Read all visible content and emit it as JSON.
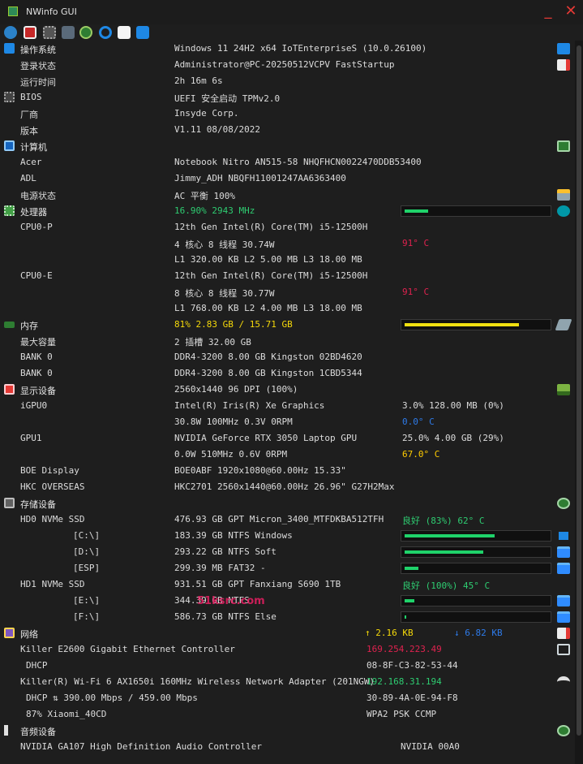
{
  "window": {
    "title": "NWinfo GUI",
    "minimize_glyph": "_",
    "close_glyph": "✕"
  },
  "toolbar": {
    "icons": [
      "globe-icon",
      "red-chip-icon",
      "chip-icon",
      "network-card-icon",
      "gear-icon",
      "refresh-icon",
      "clipboard-icon",
      "info-icon"
    ]
  },
  "os": {
    "label": "操作系统",
    "value": "Windows 11 24H2 x64 IoTEnterpriseS (10.0.26100)",
    "login_label": "登录状态",
    "login_value": "Administrator@PC-20250512VCPV FastStartup",
    "uptime_label": "运行时间",
    "uptime_value": "2h 16m 6s"
  },
  "bios": {
    "label": "BIOS",
    "value": "UEFI 安全启动 TPMv2.0",
    "vendor_label": "厂商",
    "vendor_value": "Insyde Corp.",
    "version_label": "版本",
    "version_value": "V1.11 08/08/2022"
  },
  "computer": {
    "label": "计算机",
    "acer_label": "Acer",
    "acer_value": "Notebook Nitro AN515-58 NHQFHCN0022470DDB53400",
    "adl_label": "ADL",
    "adl_value": "Jimmy_ADH NBQFH11001247AA6363400",
    "power_label": "电源状态",
    "power_value": "AC  平衡 100%"
  },
  "cpu": {
    "label": "处理器",
    "value": "16.90% 2943 MHz",
    "usage_fraction": 0.169,
    "p_label": "CPU0-P",
    "p_name": "12th Gen Intel(R) Core(TM) i5-12500H",
    "p_cores": "4 核心 8 线程 30.74W",
    "p_temp": "91° C",
    "p_cache": "L1 320.00 KB L2 5.00 MB L3 18.00 MB",
    "e_label": "CPU0-E",
    "e_name": "12th Gen Intel(R) Core(TM) i5-12500H",
    "e_cores": "8 核心 8 线程 30.77W",
    "e_temp": "91° C",
    "e_cache": "L1 768.00 KB L2 4.00 MB L3 18.00 MB"
  },
  "memory": {
    "label": "内存",
    "value": "81% 2.83 GB / 15.71 GB",
    "usage_fraction": 0.81,
    "max_label": "最大容量",
    "max_value": "2 插槽 32.00 GB",
    "bank0_label": "BANK 0",
    "bank0_value": "DDR4-3200 8.00 GB Kingston 02BD4620",
    "bank1_label": "BANK 0",
    "bank1_value": "DDR4-3200 8.00 GB Kingston 1CBD5344"
  },
  "display": {
    "label": "显示设备",
    "value": "2560x1440 96 DPI (100%)",
    "igpu_label": "iGPU0",
    "igpu_name": "Intel(R) Iris(R) Xe Graphics",
    "igpu_usage": "3.0%   128.00 MB (0%)",
    "igpu_power": "30.8W 100MHz 0.3V 0RPM",
    "igpu_temp": "0.0° C",
    "gpu1_label": "GPU1",
    "gpu1_name": "NVIDIA GeForce RTX 3050 Laptop GPU",
    "gpu1_usage": "25.0%  4.00 GB (29%)",
    "gpu1_power": "0.0W 510MHz 0.6V 0RPM",
    "gpu1_temp": "67.0° C",
    "mon1_label": "BOE Display",
    "mon1_value": "BOE0ABF 1920x1080@60.00Hz 15.33\"",
    "mon2_label": "HKC OVERSEAS",
    "mon2_value": "HKC2701 2560x1440@60.00Hz 26.96\" G27H2Max"
  },
  "storage": {
    "label": "存储设备",
    "hd0_label": "HD0 NVMe SSD",
    "hd0_value": "476.93 GB GPT Micron_3400_MTFDKBA512TFH",
    "hd0_health": "良好 (83%) 62° C",
    "c_label": "[C:\\]",
    "c_value": "183.39 GB NTFS Windows",
    "c_fraction": 0.64,
    "d_label": "[D:\\]",
    "d_value": "293.22 GB NTFS Soft",
    "d_fraction": 0.56,
    "esp_label": "[ESP]",
    "esp_value": "299.39 MB FAT32 -",
    "esp_fraction": 0.1,
    "hd1_label": "HD1 NVMe SSD",
    "hd1_value": "931.51 GB GPT Fanxiang S690 1TB",
    "hd1_health": "良好 (100%) 45° C",
    "e_label": "[E:\\]",
    "e_value": "344.39 GB NTFS",
    "e_fraction": 0.07,
    "f_label": "[F:\\]",
    "f_value": "586.73 GB NTFS Else",
    "f_fraction": 0.01
  },
  "watermark": "51ksrc.com",
  "network": {
    "label": "网络",
    "upload": "↑ 2.16 KB",
    "download": "↓ 6.82 KB",
    "eth_label": "Killer E2600 Gigabit Ethernet Controller",
    "eth_ip": "169.254.223.49",
    "eth_dhcp_label": "DHCP",
    "eth_mac": "08-8F-C3-82-53-44",
    "wifi_label": "Killer(R) Wi-Fi 6 AX1650i 160MHz Wireless Network Adapter (201NGW)",
    "wifi_ip": "192.168.31.194",
    "wifi_dhcp_label": "DHCP ⇅ 390.00 Mbps / 459.00 Mbps",
    "wifi_mac": "30-89-4A-0E-94-F8",
    "wifi_ssid": "87% Xiaomi_40CD",
    "wifi_security": "WPA2 PSK CCMP"
  },
  "audio": {
    "label": "音频设备",
    "dev_label": "NVIDIA GA107 High Definition Audio Controller",
    "dev_value": "NVIDIA 00A0"
  },
  "colors": {
    "bar_green": "#1fd26a",
    "bar_yellow": "#f0e010",
    "folder_blue": "#2f8cff"
  }
}
